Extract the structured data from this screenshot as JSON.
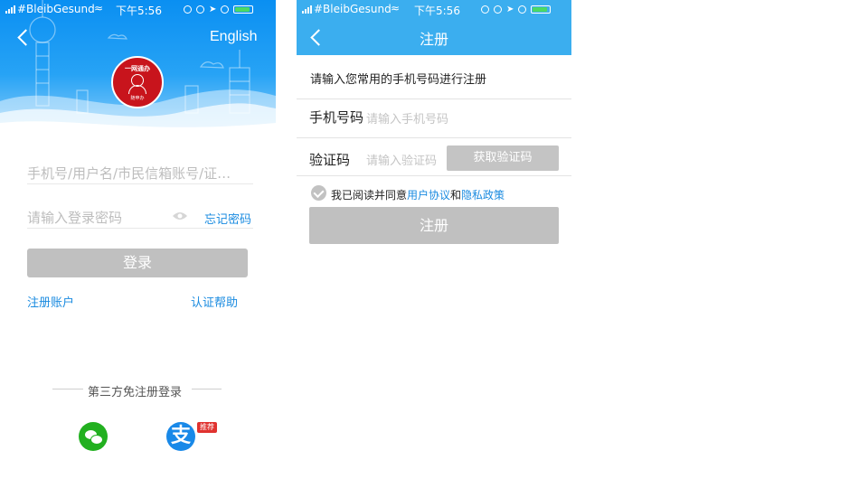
{
  "login": {
    "status_bar": {
      "carrier": "#BleibGesund",
      "time": "下午5:56"
    },
    "language_link": "English",
    "logo": {
      "top_text": "一网通办",
      "bottom_text": "随申办"
    },
    "username_placeholder": "手机号/用户名/市民信箱账号/证…",
    "password_placeholder": "请输入登录密码",
    "forgot_password": "忘记密码",
    "login_button": "登录",
    "register_link": "注册账户",
    "auth_help_link": "认证帮助",
    "third_party_label": "第三方免注册登录",
    "alipay_glyph": "支",
    "alipay_badge": "推荐",
    "colors": {
      "hero_blue": "#1a9af2",
      "link_blue": "#1a8be0",
      "logo_red": "#c8141c",
      "wechat_green": "#22b020"
    }
  },
  "register": {
    "status_bar": {
      "carrier": "#BleibGesund",
      "time": "下午5:56"
    },
    "title": "注册",
    "instruction": "请输入您常用的手机号码进行注册",
    "phone_label": "手机号码",
    "phone_placeholder": "请输入手机号码",
    "code_label": "验证码",
    "code_placeholder": "请输入验证码",
    "get_code_button": "获取验证码",
    "agree_prefix": "我已阅读并同意",
    "user_agreement": "用户协议",
    "and": "和",
    "privacy_policy": "隐私政策",
    "register_button": "注册",
    "colors": {
      "nav_blue": "#3baeef",
      "button_gray": "#c0c0c0"
    }
  }
}
